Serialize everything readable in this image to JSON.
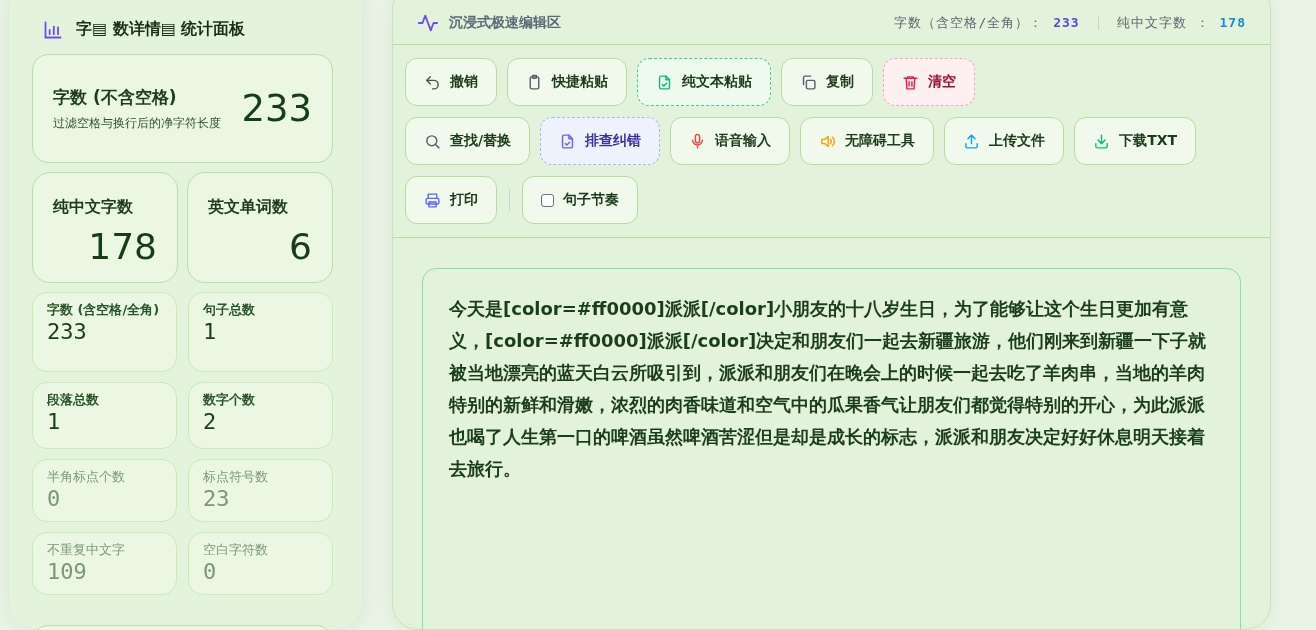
{
  "stats_panel": {
    "title": "字▤ 数详情▤ 统计面板",
    "hero": {
      "label": "字数 (不含空格)",
      "note": "过滤空格与换行后的净字符长度",
      "value": "233"
    },
    "pair": [
      {
        "label": "纯中文字数",
        "value": "178"
      },
      {
        "label": "英文单词数",
        "value": "6"
      }
    ],
    "stats": [
      {
        "label": "字数 (含空格/全角)",
        "value": "233",
        "dim": false
      },
      {
        "label": "句子总数",
        "value": "1",
        "dim": false
      },
      {
        "label": "段落总数",
        "value": "1",
        "dim": false
      },
      {
        "label": "数字个数",
        "value": "2",
        "dim": false
      },
      {
        "label": "半角标点个数",
        "value": "0",
        "dim": true
      },
      {
        "label": "标点符号数",
        "value": "23",
        "dim": true
      },
      {
        "label": "不重复中文字",
        "value": "109",
        "dim": true
      },
      {
        "label": "空白字符数",
        "value": "0",
        "dim": true
      }
    ]
  },
  "editor": {
    "title": "沉浸式极速编辑区",
    "counters": [
      {
        "label": "字数（含空格/全角）：",
        "value": "233"
      },
      {
        "label": "纯中文字数 ：",
        "value": "178"
      }
    ],
    "toolbar_rows": [
      [
        {
          "kind": "button",
          "label": "撤销"
        },
        {
          "kind": "button",
          "label": "快捷粘贴"
        },
        {
          "kind": "button",
          "label": "纯文本粘贴"
        },
        {
          "kind": "button",
          "label": "复制"
        },
        {
          "kind": "button",
          "label": "清空"
        }
      ],
      [
        {
          "kind": "button",
          "label": "查找/替换"
        },
        {
          "kind": "button",
          "label": "排查纠错"
        },
        {
          "kind": "button",
          "label": "语音输入"
        },
        {
          "kind": "button",
          "label": "无障碍工具"
        },
        {
          "kind": "button",
          "label": "上传文件"
        },
        {
          "kind": "button",
          "label": "下载TXT"
        }
      ],
      [
        {
          "kind": "button",
          "label": "打印"
        },
        {
          "kind": "checkbox",
          "checked": false,
          "label": "句子节奏"
        }
      ]
    ],
    "text": "今天是[color=#ff0000]派派[/color]小朋友的十八岁生日，为了能够让这个生日更加有意义，[color=#ff0000]派派[/color]决定和朋友们一起去新疆旅游，他们刚来到新疆一下子就被当地漂亮的蓝天白云所吸引到，派派和朋友们在晚会上的时候一起去吃了羊肉串，当地的羊肉特别的新鲜和滑嫩，浓烈的肉香味道和空气中的瓜果香气让朋友们都觉得特别的开心，为此派派也喝了人生第一口的啤酒虽然啤酒苦涩但是却是成长的标志，派派和朋友决定好好休息明天接着去旅行。"
  }
}
